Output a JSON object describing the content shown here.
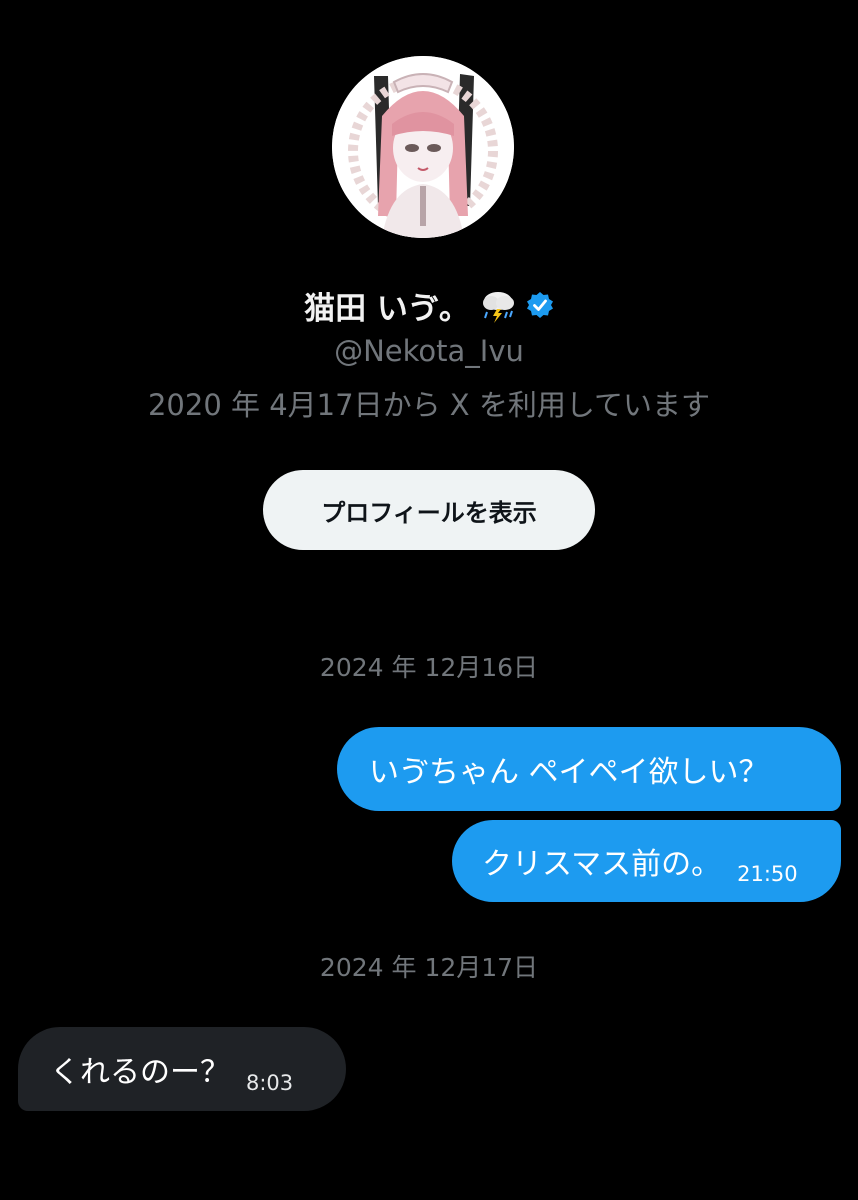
{
  "profile": {
    "display_name": "猫田 いゔ。",
    "name_emoji_icon": "cloud-with-lightning-and-rain-icon",
    "verified_icon": "verified-badge-icon",
    "verified_color": "#1d9bf0",
    "handle": "@Nekota_Ivu",
    "joined": "2020 年 4月17日から X を利用しています",
    "view_profile_label": "プロフィールを表示"
  },
  "conversation": {
    "groups": [
      {
        "date": "2024 年 12月16日",
        "messages": [
          {
            "direction": "sent",
            "text": "いゔちゃん ペイペイ欲しい？",
            "time": ""
          },
          {
            "direction": "sent",
            "text": "クリスマス前の。",
            "time": "21:50"
          }
        ]
      },
      {
        "date": "2024 年 12月17日",
        "messages": [
          {
            "direction": "received",
            "text": "くれるのー？",
            "time": "8:03"
          }
        ]
      }
    ]
  },
  "colors": {
    "background": "#000000",
    "sent_bubble": "#1d9bf0",
    "received_bubble": "#1f2226",
    "muted_text": "#71767b",
    "button_bg": "#eff3f4"
  }
}
